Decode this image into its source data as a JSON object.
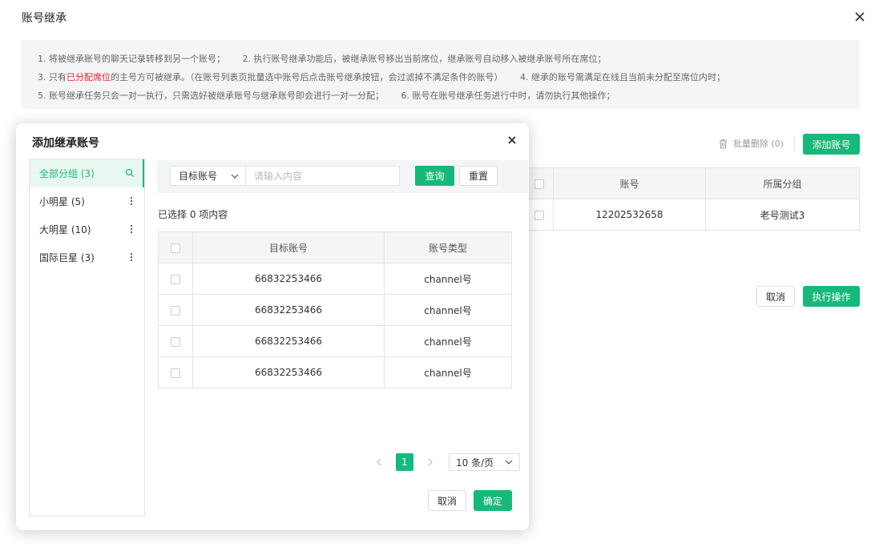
{
  "main": {
    "title": "账号继承",
    "notice": {
      "row1": [
        "1. 将被继承账号的聊天记录转移到另一个账号；",
        "2. 执行账号继承功能后，被继承账号移出当前席位，继承账号自动移入被继承账号所在席位；"
      ],
      "row2_prefix": "3. 只有",
      "row2_highlight": "已分配席位",
      "row2_suffix": "的主号方可被继承。（在账号列表页批量选中账号后点击账号继承按钮，会过滤掉不满足条件的账号）",
      "row2_item4": "4. 继承的账号需满足在线且当前未分配至席位内时；",
      "row3": [
        "5. 账号继承任务只会一对一执行，只需选好被继承账号与继承账号即会进行一对一分配；",
        "6. 账号在账号继承任务进行中时，请勿执行其他操作；"
      ]
    },
    "bulk_delete": "批量删除 (0)",
    "add_account": "添加账号",
    "table": {
      "headers": [
        "账号",
        "所属分组"
      ],
      "rows": [
        {
          "account": "12202532658",
          "group": "老号测试3"
        }
      ]
    },
    "cancel": "取消",
    "execute": "执行操作"
  },
  "modal": {
    "title": "添加继承账号",
    "groups": [
      {
        "label": "全部分组 (3)",
        "active": true
      },
      {
        "label": "小明星 (5)"
      },
      {
        "label": "大明星 (10)"
      },
      {
        "label": "国际巨星 (3)"
      }
    ],
    "search": {
      "select_value": "目标账号",
      "placeholder": "请输入内容",
      "query": "查询",
      "reset": "重置"
    },
    "selected_text": "已选择 0 项内容",
    "table": {
      "headers": [
        "目标账号",
        "账号类型"
      ],
      "rows": [
        {
          "account": "66832253466",
          "type": "channel号"
        },
        {
          "account": "66832253466",
          "type": "channel号"
        },
        {
          "account": "66832253466",
          "type": "channel号"
        },
        {
          "account": "66832253466",
          "type": "channel号"
        }
      ]
    },
    "pagination": {
      "current_page": "1",
      "page_size": "10 条/页"
    },
    "cancel": "取消",
    "confirm": "确定"
  },
  "colors": {
    "accent": "#16b97a",
    "highlight": "#f5222d"
  }
}
